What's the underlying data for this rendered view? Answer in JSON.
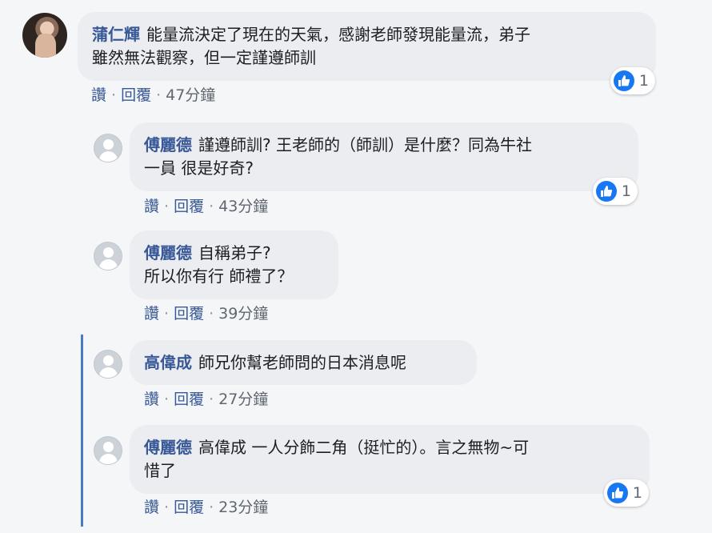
{
  "comments": [
    {
      "author": "蒲仁輝",
      "line1": "能量流決定了現在的天氣，感謝老師發現能量流，弟子",
      "line2": "雖然無法觀察，但一定謹遵師訓",
      "like": "讚",
      "reply": "回覆",
      "time": "47分鐘",
      "reactions": "1"
    },
    {
      "author": "傅麗德",
      "line1": "謹遵師訓? 王老師的（師訓）是什麼？同為牛社",
      "line2": "一員 很是好奇?",
      "like": "讚",
      "reply": "回覆",
      "time": "43分鐘",
      "reactions": "1"
    },
    {
      "author": "傅麗德",
      "line1": "自稱弟子?",
      "line2": "所以你有行 師禮了？",
      "like": "讚",
      "reply": "回覆",
      "time": "39分鐘"
    },
    {
      "author": "高偉成",
      "line1": "師兄你幫老師問的日本消息呢",
      "like": "讚",
      "reply": "回覆",
      "time": "27分鐘"
    },
    {
      "author": "傅麗德",
      "line1": "高偉成 一人分飾二角（挺忙的）。言之無物~可",
      "line2": "惜了",
      "like": "讚",
      "reply": "回覆",
      "time": "23分鐘",
      "reactions": "1"
    }
  ],
  "icons": {
    "like": "thumbs-up-icon",
    "avatar": "default-user-icon"
  },
  "colors": {
    "author": "#385898",
    "like_blue": "#1877f2",
    "bubble": "#ebedf0",
    "thread_line": "#4a79c6"
  }
}
